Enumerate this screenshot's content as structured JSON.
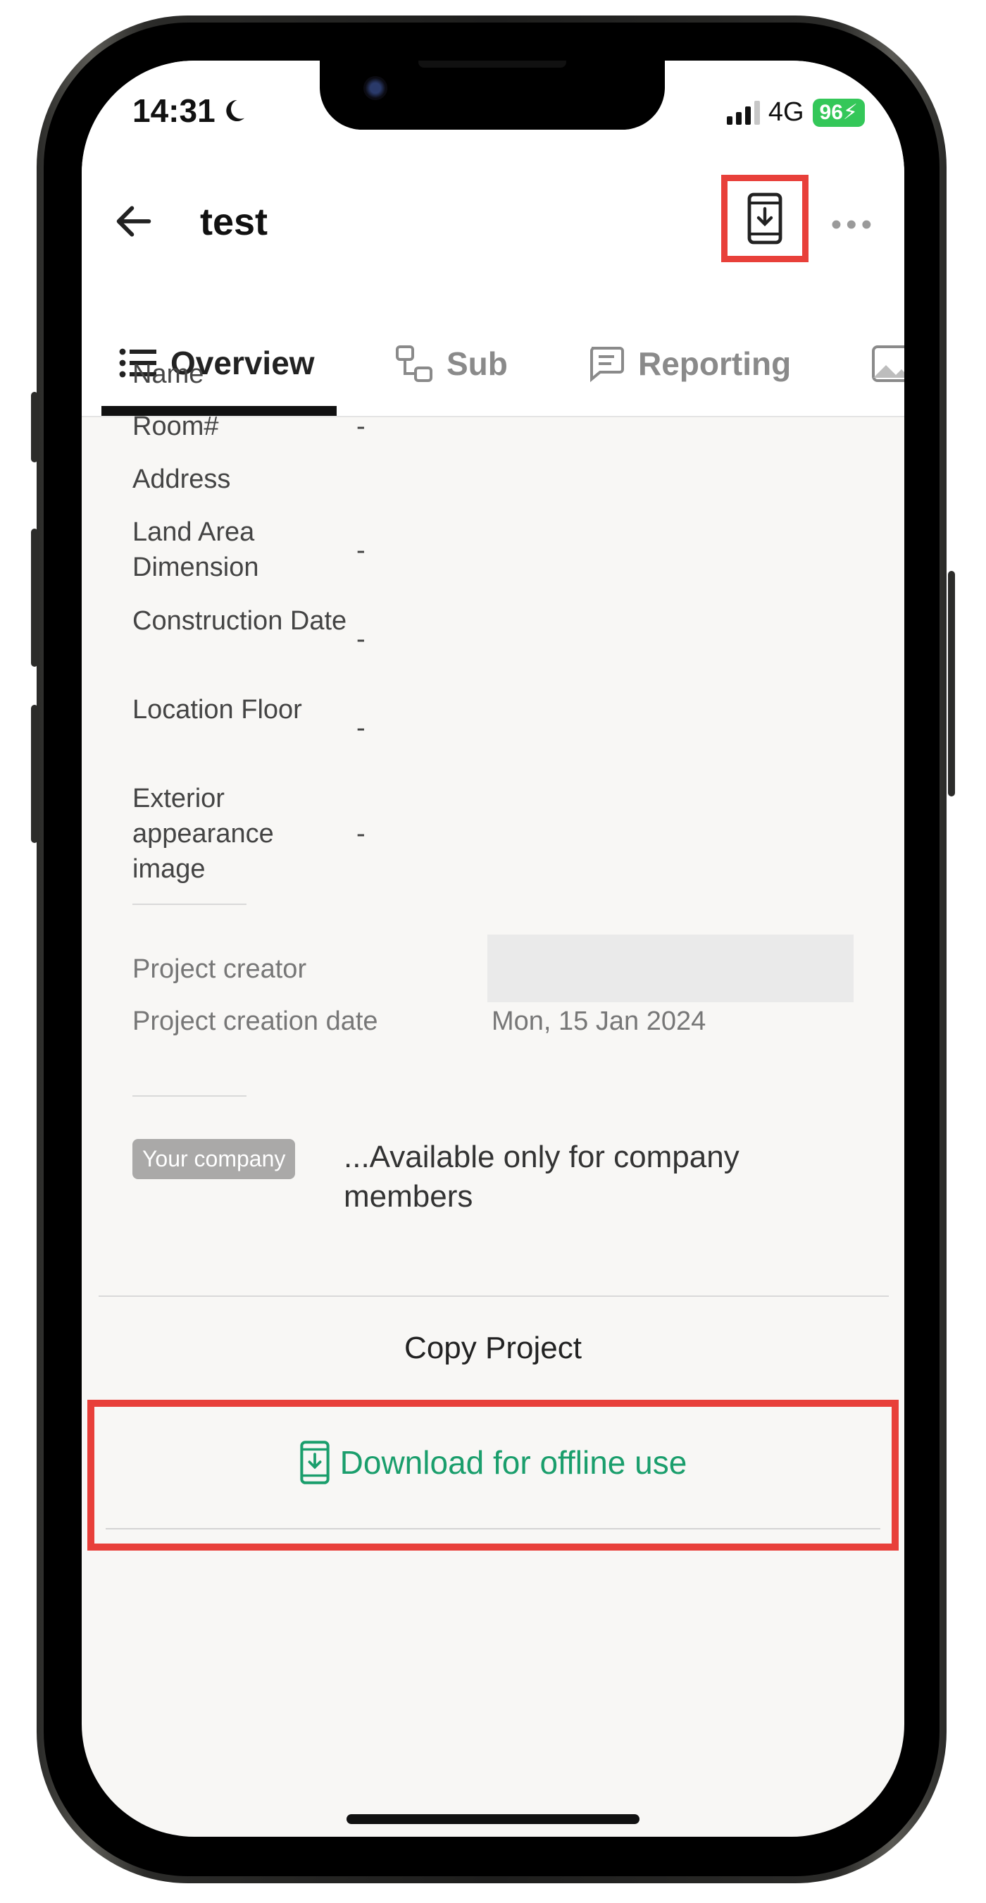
{
  "status_bar": {
    "time": "14:31",
    "network": "4G",
    "battery": "96"
  },
  "header": {
    "title": "test",
    "back_icon": "arrow-left-icon",
    "download_icon": "phone-download-icon",
    "more_icon": "more-horizontal-icon"
  },
  "tabs": [
    {
      "label": "Overview",
      "icon": "list-icon",
      "active": true
    },
    {
      "label": "Sub",
      "icon": "hierarchy-icon",
      "active": false
    },
    {
      "label": "Reporting",
      "icon": "chat-icon",
      "active": false
    }
  ],
  "fields": [
    {
      "label": "Name",
      "value": ""
    },
    {
      "label": "Room#",
      "value": "-"
    },
    {
      "label": "Address",
      "value": ""
    },
    {
      "label": "Land Area Dimension",
      "value": "-"
    },
    {
      "label": "Construction Date",
      "value": "-"
    },
    {
      "label": "Location Floor",
      "value": "-"
    },
    {
      "label": "Exterior appearance image",
      "value": "-"
    }
  ],
  "meta": {
    "creator_label": "Project creator",
    "creation_date_label": "Project creation date",
    "creation_date_value": "Mon, 15 Jan 2024"
  },
  "company": {
    "badge": "Your company",
    "text": "...Available only for company members"
  },
  "actions": {
    "copy_project": "Copy Project",
    "download_offline": "Download for offline use"
  },
  "colors": {
    "highlight": "#e8403a",
    "accent_green": "#1a9e6c",
    "battery_green": "#34c759"
  }
}
